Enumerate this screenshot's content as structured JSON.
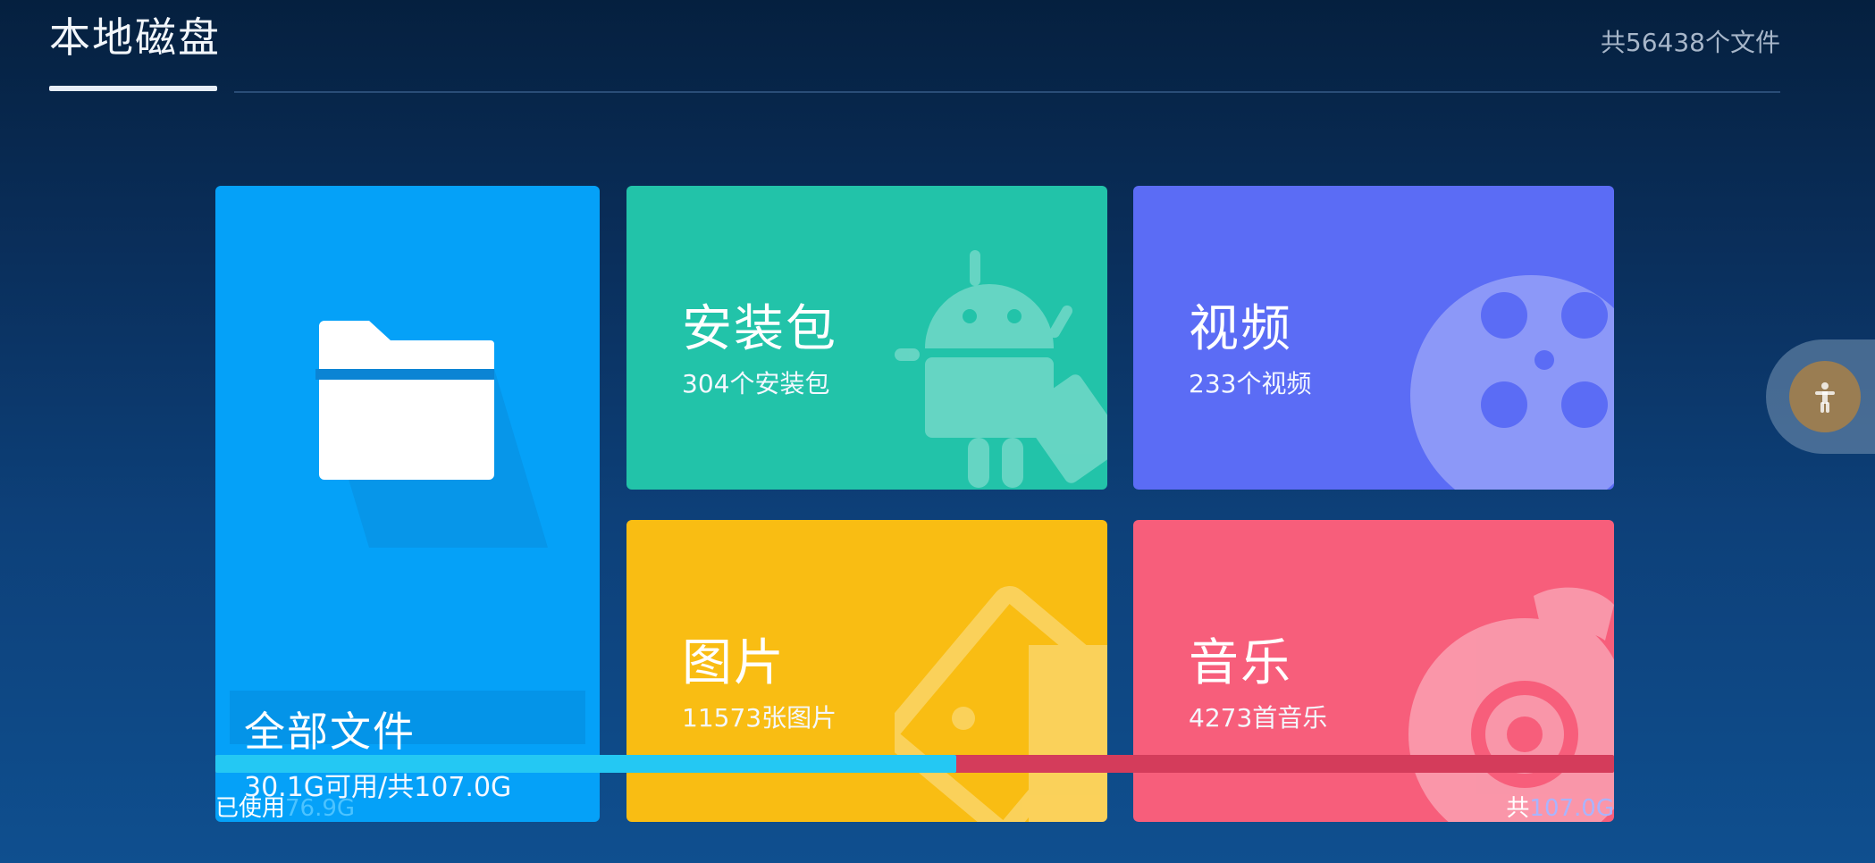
{
  "header": {
    "title": "本地磁盘",
    "file_count": "共56438个文件"
  },
  "cards": {
    "all": {
      "title": "全部文件",
      "sub": "30.1G可用/共107.0G"
    },
    "apk": {
      "title": "安装包",
      "sub": "304个安装包"
    },
    "video": {
      "title": "视频",
      "sub": "233个视频"
    },
    "image": {
      "title": "图片",
      "sub": "11573张图片"
    },
    "music": {
      "title": "音乐",
      "sub": "4273首音乐"
    }
  },
  "storage": {
    "used_label": "已使用",
    "used_value": "76.9G",
    "total_label": "共",
    "total_value": "107.0G",
    "used_fraction": 0.53
  },
  "colors": {
    "all": "#05a1f8",
    "apk": "#22c3a9",
    "video": "#5b6cf5",
    "image": "#f9bd13",
    "music": "#f75e7b",
    "progress_used": "#24c8f3",
    "progress_track": "#d43c5b"
  },
  "icons": {
    "all": "folder-icon",
    "apk": "android-icon",
    "video": "film-reel-icon",
    "image": "picture-icon",
    "music": "music-disc-icon",
    "float": "accessibility-icon"
  }
}
